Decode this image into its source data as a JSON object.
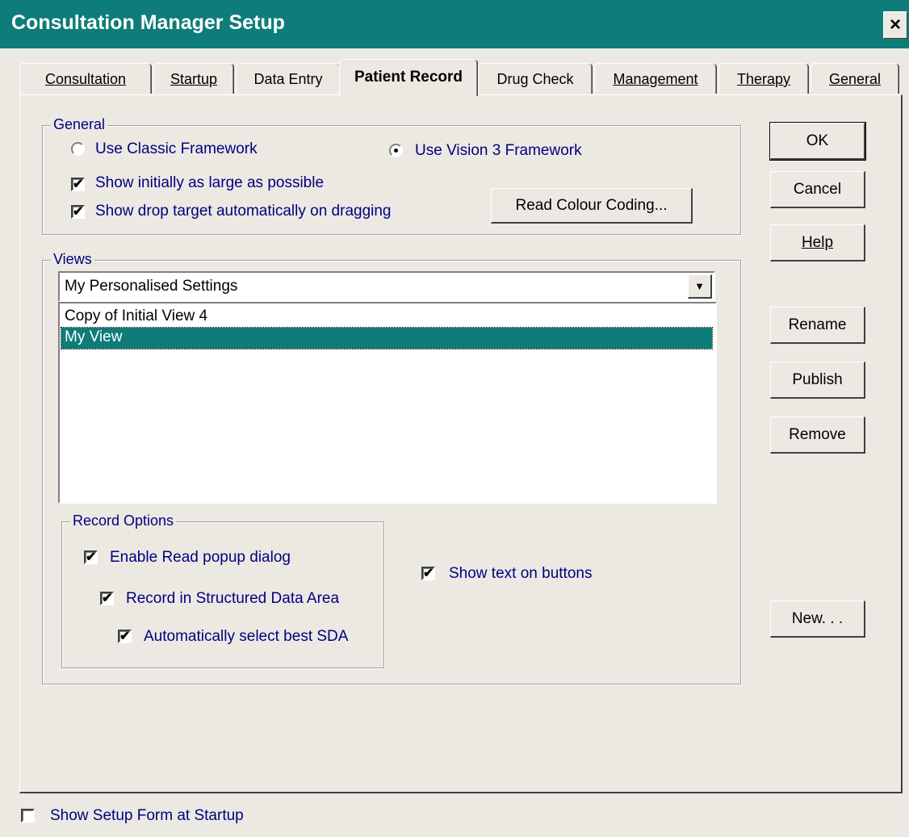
{
  "window": {
    "title": "Consultation Manager Setup",
    "close_glyph": "×"
  },
  "tabs": [
    {
      "label": "Consultation",
      "active": false
    },
    {
      "label": "Startup",
      "active": false
    },
    {
      "label": "Data Entry",
      "active": false
    },
    {
      "label": "Patient Record",
      "active": true
    },
    {
      "label": "Drug Check",
      "active": false
    },
    {
      "label": "Management",
      "active": false
    },
    {
      "label": "Therapy",
      "active": false
    },
    {
      "label": "General",
      "active": false
    }
  ],
  "general": {
    "legend": "General",
    "classic_label": "Use Classic Framework",
    "classic_selected": false,
    "vision3_label": "Use Vision 3 Framework",
    "vision3_selected": true,
    "large_label": "Show initially as large as possible",
    "large_checked": true,
    "drop_label": "Show drop target automatically on dragging",
    "drop_checked": true,
    "read_colour_button": "Read Colour Coding..."
  },
  "views": {
    "legend": "Views",
    "selected": "My Personalised Settings",
    "items": [
      "Copy of Initial View 4",
      "My View"
    ],
    "selected_index": 1
  },
  "record_options": {
    "legend": "Record Options",
    "enable_popup_label": "Enable Read popup dialog",
    "enable_popup_checked": true,
    "record_sda_label": "Record in Structured Data Area",
    "record_sda_checked": true,
    "auto_sda_label": "Automatically select best SDA",
    "auto_sda_checked": true
  },
  "show_text_buttons": {
    "label": "Show text on buttons",
    "checked": true
  },
  "buttons": {
    "ok": "OK",
    "cancel": "Cancel",
    "help": "Help",
    "rename": "Rename",
    "publish": "Publish",
    "remove": "Remove",
    "new": "New. . ."
  },
  "footer": {
    "show_setup_label": "Show Setup Form at Startup",
    "show_setup_checked": false
  },
  "colors": {
    "titlebar": "#0E7C78",
    "selection": "#0E7C78",
    "label_text": "#000080",
    "face": "#ECE9E3"
  },
  "icons": {
    "check": "✔",
    "dropdown": "▼"
  }
}
